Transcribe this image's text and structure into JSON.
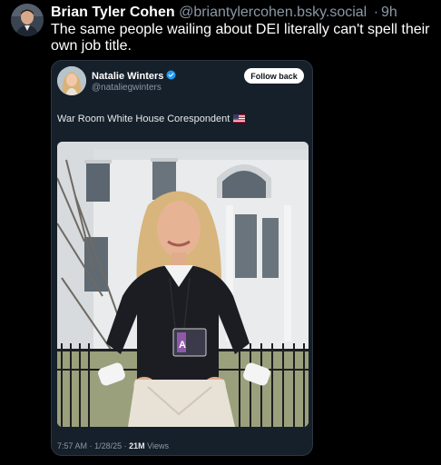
{
  "post": {
    "author_name": "Brian Tyler Cohen",
    "handle": "@briantylercohen.bsky.social",
    "separator": "·",
    "time": "9h",
    "text": "The same people wailing about DEI literally can't spell their own job title.",
    "avatar_icon": "person-avatar"
  },
  "quote": {
    "author_name": "Natalie Winters",
    "verified_icon": "verified-badge-icon",
    "handle": "@nataliegwinters",
    "follow_label": "Follow back",
    "text": "War Room White House Corespondent",
    "flag_icon": "us-flag-icon",
    "photo": {
      "description_icon": "photo-woman-white-house",
      "badge_letter": "A"
    },
    "footer": {
      "time": "7:57 AM",
      "sep1": "·",
      "date": "1/28/25",
      "sep2": "·",
      "views_count": "21M",
      "views_label": "Views"
    }
  },
  "colors": {
    "background": "#000000",
    "quote_background": "#15202b",
    "secondary_text": "#8b98a5",
    "verified_blue": "#1d9bf0"
  }
}
